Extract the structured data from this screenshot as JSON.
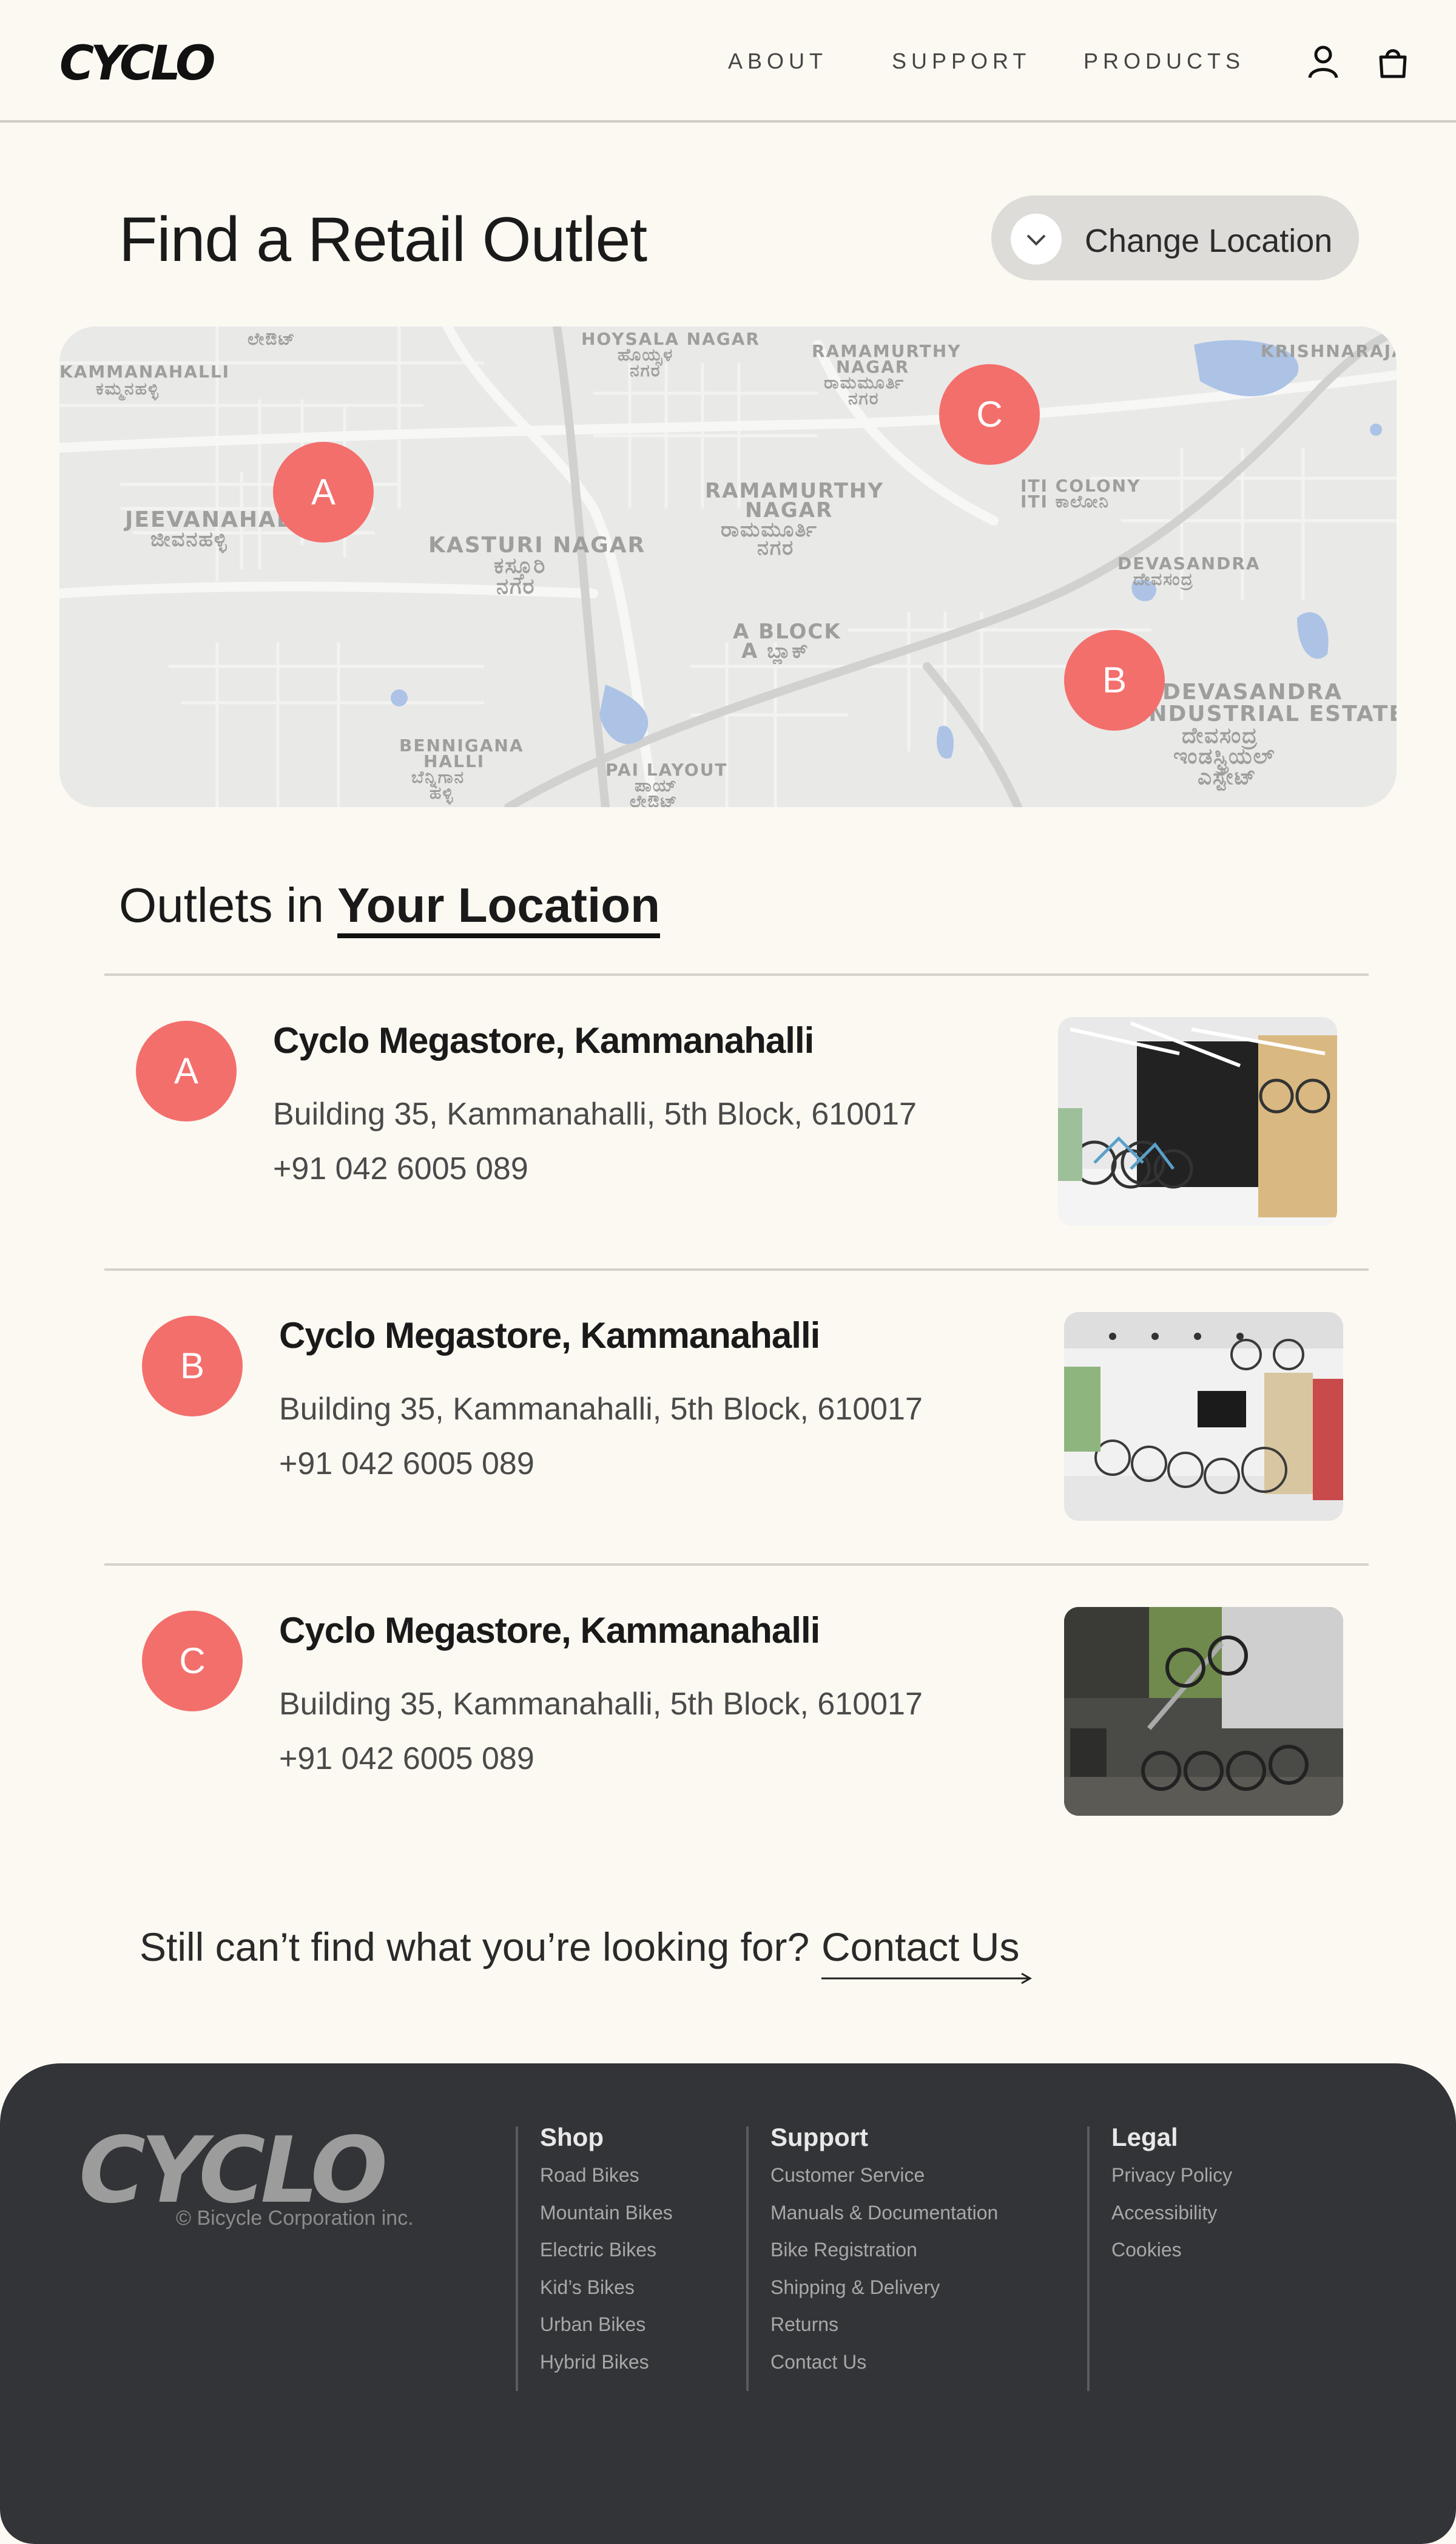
{
  "header": {
    "logo": "CYCLO",
    "nav": [
      "ABOUT",
      "SUPPORT",
      "PRODUCTS"
    ],
    "icons": [
      "user-icon",
      "bag-icon"
    ]
  },
  "page": {
    "title": "Find a Retail Outlet",
    "change_location_label": "Change Location"
  },
  "map": {
    "labels": [
      "KAMMANAHALLI",
      "ಕಮ್ಮನಹಳ್ಳಿ",
      "HOYSALA NAGAR",
      "ಹೊಯ್ಸಳ",
      "ನಗರ",
      "RAMAMURTHY",
      "NAGAR",
      "ರಾಮಮೂರ್ತಿ",
      "ನಗರ",
      "KRISHNARAJAPURAM",
      "JEEVANAHALLI",
      "ಜೀವನಹಳ್ಳಿ",
      "KASTURI NAGAR",
      "ಕಸ್ತೂರಿ",
      "ನಗರ",
      "RAMAMURTHY",
      "NAGAR",
      "ರಾಮಮೂರ್ತಿ",
      "ನಗರ",
      "ITI COLONY",
      "ITI ಕಾಲೋನಿ",
      "DEVASANDRA",
      "ದೇವಸಂದ್ರ",
      "A BLOCK",
      "A ಬ್ಲಾಕ್",
      "DEVASANDRA",
      "INDUSTRIAL ESTATE",
      "ದೇವಸಂದ್ರ",
      "ಇಂಡಸ್ಟ್ರಿಯಲ್",
      "ಎಸ್ಟೇಟ್",
      "BENNIGANA",
      "HALLI",
      "ಬೆನ್ನಿಗಾನ",
      "ಹಳ್ಳಿ",
      "PAI LAYOUT",
      "ಪಾಯ್",
      "ಲೇಔಟ್",
      "ಲೇಔಟ್"
    ],
    "pins": [
      "A",
      "B",
      "C"
    ]
  },
  "outlets": {
    "title_prefix": "Outlets in",
    "title_emphasis": "Your Location",
    "items": [
      {
        "marker": "A",
        "name": "Cyclo Megastore, Kammanahalli",
        "address": "Building 35, Kammanahalli, 5th Block, 610017",
        "phone": "+91 042 6005 089"
      },
      {
        "marker": "B",
        "name": "Cyclo Megastore, Kammanahalli",
        "address": "Building 35, Kammanahalli, 5th Block, 610017",
        "phone": "+91 042 6005 089"
      },
      {
        "marker": "C",
        "name": "Cyclo Megastore, Kammanahalli",
        "address": "Building 35, Kammanahalli, 5th Block, 610017",
        "phone": "+91 042 6005 089"
      }
    ]
  },
  "cta": {
    "text": "Still can’t find what you’re looking for?",
    "link": "Contact Us"
  },
  "footer": {
    "logo": "CYCLO",
    "copyright": "© Bicycle Corporation inc.",
    "columns": [
      {
        "heading": "Shop",
        "items": [
          "Road Bikes",
          "Mountain Bikes",
          "Electric Bikes",
          "Kid’s Bikes",
          "Urban Bikes",
          "Hybrid Bikes"
        ]
      },
      {
        "heading": "Support",
        "items": [
          "Customer Service",
          "Manuals & Documentation",
          "Bike Registration",
          "Shipping & Delivery",
          "Returns",
          "Contact Us"
        ]
      },
      {
        "heading": "Legal",
        "items": [
          "Privacy Policy",
          "Accessibility",
          "Cookies"
        ]
      }
    ]
  },
  "colors": {
    "background": "#fcf9f2",
    "accent_pin": "#f36f6c",
    "footer": "#333437"
  }
}
